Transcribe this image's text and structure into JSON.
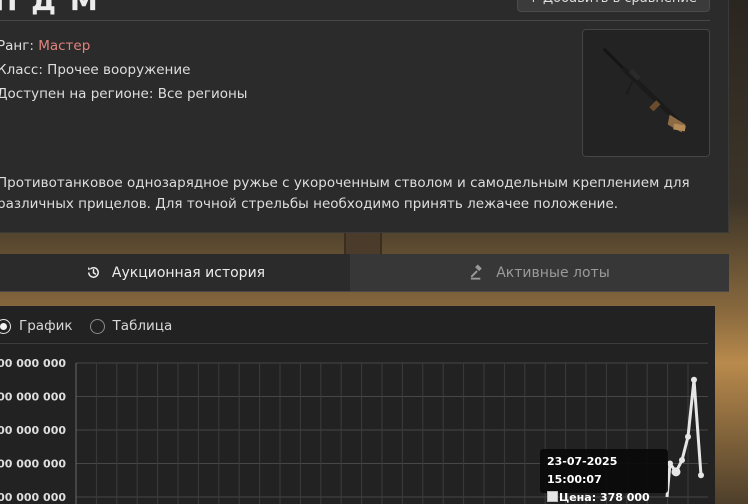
{
  "item": {
    "title": "П Д М",
    "compare_button": "+ Добавить в сравнение",
    "rank_label": "Ранг: ",
    "rank_value": "Мастер",
    "class_text": "Класс: Прочее вооружение",
    "region_text": "Доступен на регионе: Все регионы",
    "description": "Противотанковое однозарядное ружье с укороченным стволом и самодельным креплением для различных прицелов. Для точной стрельбы необходимо принять лежачее положение.",
    "image_icon": "anti-tank-rifle-icon"
  },
  "tabs": {
    "history": {
      "label": "Аукционная история",
      "icon": "history-icon"
    },
    "lots": {
      "label": "Активные лоты",
      "icon": "gavel-icon"
    }
  },
  "view_mode": {
    "graph_label": "График",
    "table_label": "Таблица",
    "selected": "graph"
  },
  "chart_data": {
    "type": "line",
    "y_ticks": [
      "700 000 000",
      "600 000 000",
      "500 000 000",
      "400 000 000",
      "300 000 000"
    ],
    "y_tick_values": [
      700000000,
      600000000,
      500000000,
      400000000,
      300000000
    ],
    "ylim": [
      300000000,
      700000000
    ],
    "grid": true,
    "line_color": "#e6e6e6",
    "series": [
      {
        "values": [
          300000000,
          400000000,
          375000000,
          410000000,
          480000000,
          650000000,
          365000000
        ]
      }
    ],
    "highlight_index": 2,
    "tooltip": {
      "date": "23-07-2025 15:00:07",
      "price": "Цена: 378 000 000"
    }
  }
}
